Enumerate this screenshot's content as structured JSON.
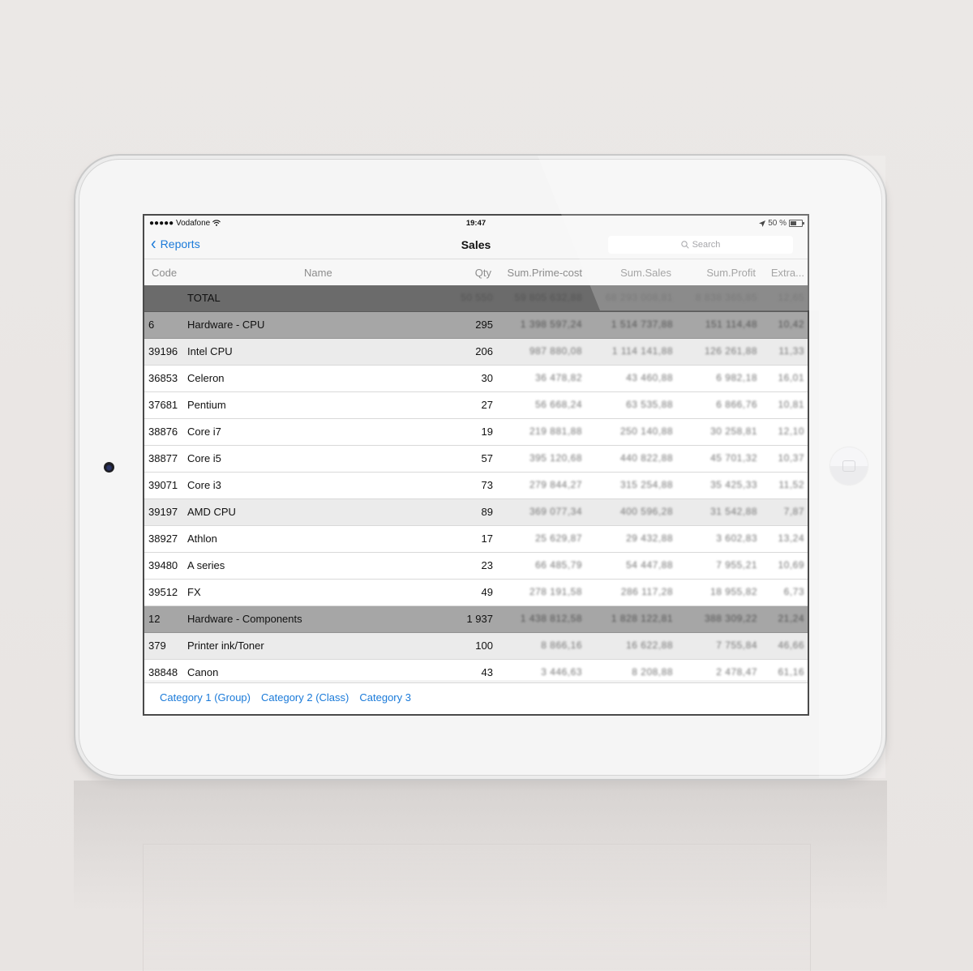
{
  "statusbar": {
    "carrier": "●●●●● Vodafone",
    "wifi_icon": "wifi-icon",
    "time": "19:47",
    "location_icon": "location-arrow-icon",
    "battery_text": "50 %",
    "battery_level": 0.5
  },
  "navbar": {
    "back_label": "Reports",
    "title": "Sales",
    "search_placeholder": "Search"
  },
  "table": {
    "columns": {
      "code": "Code",
      "name": "Name",
      "qty": "Qty",
      "prime_cost": "Sum.Prime-cost",
      "sales": "Sum.Sales",
      "profit": "Sum.Profit",
      "extra": "Extra..."
    },
    "rows": [
      {
        "type": "total",
        "code": "",
        "name": "TOTAL",
        "qty": "50 550",
        "prime": "59 805 632,88",
        "sales": "68 293 008,81",
        "profit": "8 838 365,85",
        "extra": "12,65"
      },
      {
        "type": "group",
        "code": "6",
        "name": "Hardware - CPU",
        "qty": "295",
        "prime": "1 398 597,24",
        "sales": "1 514 737,88",
        "profit": "151 114,48",
        "extra": "10,42"
      },
      {
        "type": "subgroup",
        "code": "39196",
        "name": "Intel CPU",
        "qty": "206",
        "prime": "987 880,08",
        "sales": "1 114 141,88",
        "profit": "126 261,88",
        "extra": "11,33"
      },
      {
        "type": "item",
        "code": "36853",
        "name": "Celeron",
        "qty": "30",
        "prime": "36 478,82",
        "sales": "43 460,88",
        "profit": "6 982,18",
        "extra": "16,01"
      },
      {
        "type": "item",
        "code": "37681",
        "name": "Pentium",
        "qty": "27",
        "prime": "56 668,24",
        "sales": "63 535,88",
        "profit": "6 866,76",
        "extra": "10,81"
      },
      {
        "type": "item",
        "code": "38876",
        "name": "Core i7",
        "qty": "19",
        "prime": "219 881,88",
        "sales": "250 140,88",
        "profit": "30 258,81",
        "extra": "12,10"
      },
      {
        "type": "item",
        "code": "38877",
        "name": "Core i5",
        "qty": "57",
        "prime": "395 120,68",
        "sales": "440 822,88",
        "profit": "45 701,32",
        "extra": "10,37"
      },
      {
        "type": "item",
        "code": "39071",
        "name": "Core i3",
        "qty": "73",
        "prime": "279 844,27",
        "sales": "315 254,88",
        "profit": "35 425,33",
        "extra": "11,52"
      },
      {
        "type": "subgroup",
        "code": "39197",
        "name": "AMD CPU",
        "qty": "89",
        "prime": "369 077,34",
        "sales": "400 596,28",
        "profit": "31 542,88",
        "extra": "7,87"
      },
      {
        "type": "item",
        "code": "38927",
        "name": "Athlon",
        "qty": "17",
        "prime": "25 629,87",
        "sales": "29 432,88",
        "profit": "3 602,83",
        "extra": "13,24"
      },
      {
        "type": "item",
        "code": "39480",
        "name": "A series",
        "qty": "23",
        "prime": "66 485,79",
        "sales": "54 447,88",
        "profit": "7 955,21",
        "extra": "10,69"
      },
      {
        "type": "item",
        "code": "39512",
        "name": "FX",
        "qty": "49",
        "prime": "278 191,58",
        "sales": "286 117,28",
        "profit": "18 955,82",
        "extra": "6,73"
      },
      {
        "type": "group",
        "code": "12",
        "name": "Hardware - Components",
        "qty": "1 937",
        "prime": "1 438 812,58",
        "sales": "1 828 122,81",
        "profit": "388 309,22",
        "extra": "21,24"
      },
      {
        "type": "subgroup",
        "code": "379",
        "name": "Printer ink/Toner",
        "qty": "100",
        "prime": "8 866,16",
        "sales": "16 622,88",
        "profit": "7 755,84",
        "extra": "46,66"
      },
      {
        "type": "item",
        "code": "38848",
        "name": "Canon",
        "qty": "43",
        "prime": "3 446,63",
        "sales": "8 208,88",
        "profit": "2 478,47",
        "extra": "61,16"
      }
    ]
  },
  "footer": {
    "tabs": [
      "Category 1 (Group)",
      "Category 2 (Class)",
      "Category 3"
    ]
  },
  "colors": {
    "accent": "#1a7ad9",
    "total_row": "#6b6b6b",
    "group_row": "#a6a6a6",
    "subgroup_row": "#ebebeb"
  }
}
